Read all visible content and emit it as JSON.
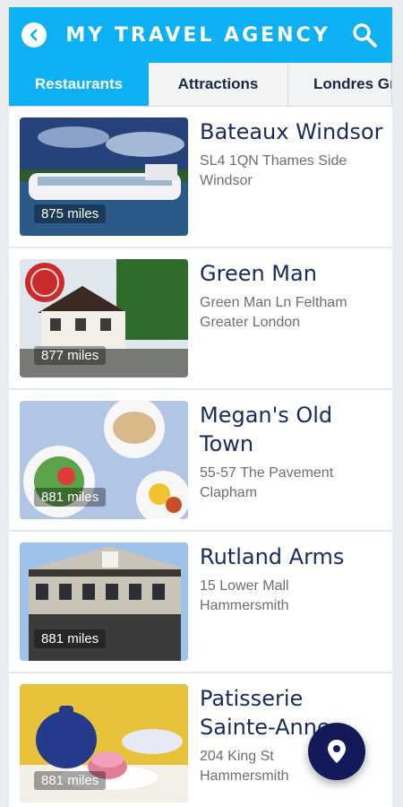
{
  "header": {
    "title": "MY TRAVEL AGENCY",
    "back_icon": "chevron-left-icon",
    "search_icon": "search-icon"
  },
  "tabs": [
    {
      "label": "Restaurants",
      "active": true
    },
    {
      "label": "Attractions",
      "active": false
    },
    {
      "label": "Londres Gr",
      "active": false
    }
  ],
  "places": [
    {
      "name": "Bateaux Windsor",
      "address_line1": "SL4 1QN Thames Side",
      "address_line2": "Windsor",
      "distance": "875 miles"
    },
    {
      "name": "Green Man",
      "address_line1": "Green Man Ln Feltham",
      "address_line2": "Greater London",
      "distance": "877 miles"
    },
    {
      "name": "Megan's Old Town",
      "address_line1": "55-57 The Pavement",
      "address_line2": "Clapham",
      "distance": "881 miles"
    },
    {
      "name": "Rutland Arms",
      "address_line1": "15 Lower Mall",
      "address_line2": "Hammersmith",
      "distance": "881 miles"
    },
    {
      "name": "Patisserie Sainte-Anne",
      "address_line1": "204 King St",
      "address_line2": "Hammersmith",
      "distance": "881 miles"
    }
  ],
  "fab": {
    "icon": "map-pin-icon"
  },
  "colors": {
    "accent": "#0db1f3",
    "title_text": "#1b2a5c",
    "fab": "#14195a"
  }
}
